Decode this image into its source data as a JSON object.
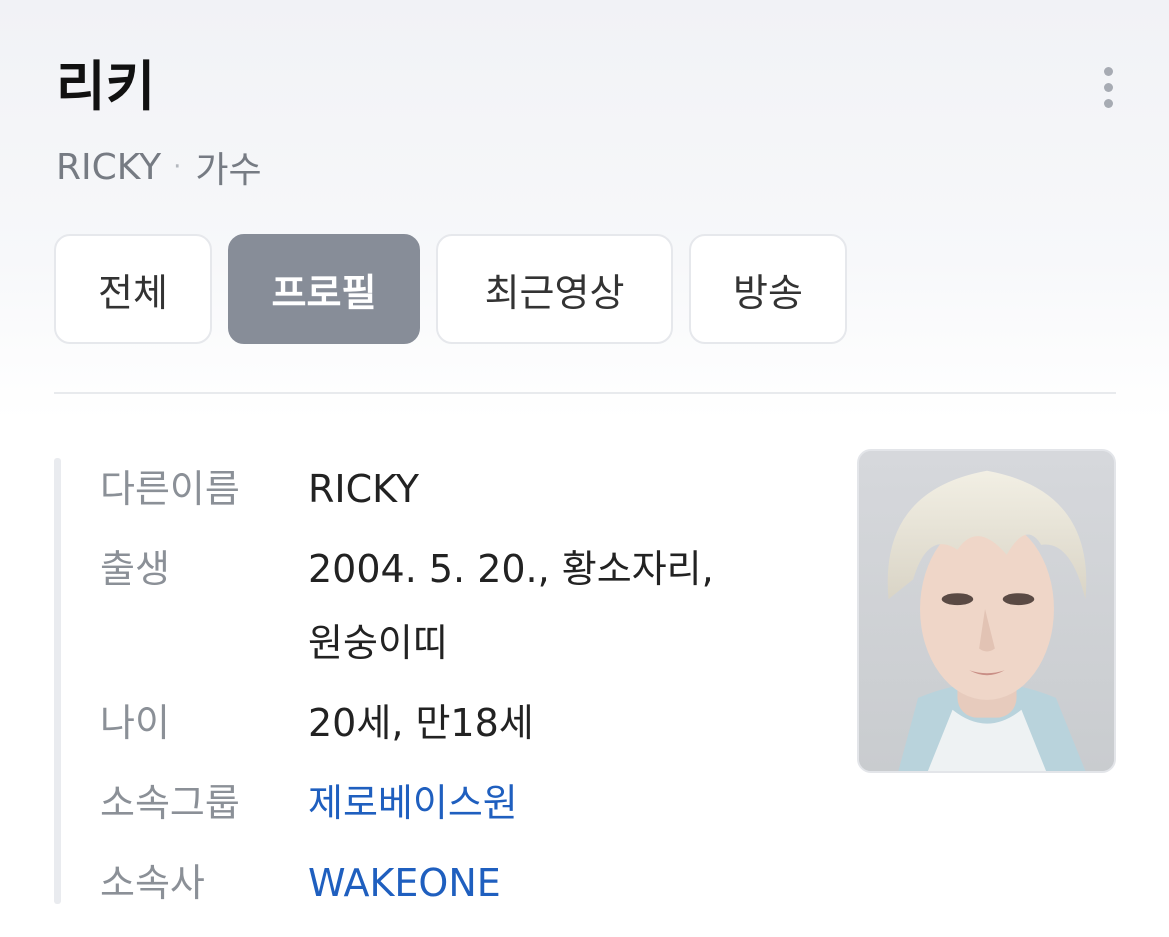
{
  "header": {
    "title": "리키",
    "subtitle_name": "RICKY",
    "subtitle_sep": "·",
    "subtitle_role": "가수"
  },
  "tabs": [
    {
      "label": "전체",
      "active": false
    },
    {
      "label": "프로필",
      "active": true
    },
    {
      "label": "최근영상",
      "active": false
    },
    {
      "label": "방송",
      "active": false
    }
  ],
  "profile": {
    "rows": [
      {
        "label": "다른이름",
        "value": "RICKY"
      },
      {
        "label": "출생",
        "value_line1": "2004. 5. 20., 황소자리,",
        "value_line2": "원숭이띠"
      },
      {
        "label": "나이",
        "value": "20세, 만18세"
      },
      {
        "label": "소속그룹",
        "value": "제로베이스원"
      },
      {
        "label": "소속사",
        "value": "WAKEONE"
      }
    ]
  },
  "icons": {
    "more": "more-vertical-icon"
  },
  "colors": {
    "active_tab": "#878d98",
    "link": "#1f5fbf",
    "label": "#8b9097"
  }
}
